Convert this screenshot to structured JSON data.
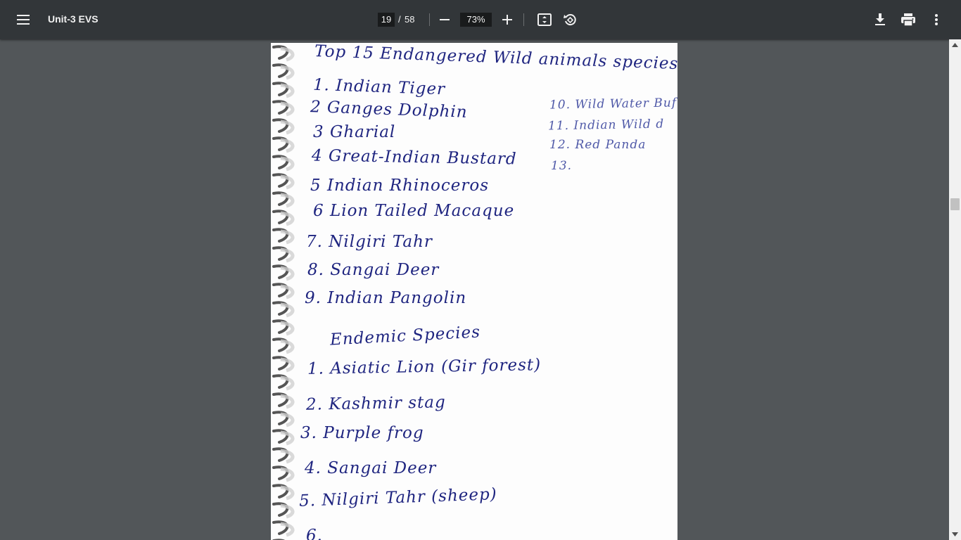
{
  "toolbar": {
    "title": "Unit-3 EVS",
    "page_current": "19",
    "page_separator": "/",
    "page_total": "58",
    "zoom": "73%",
    "icons": {
      "menu": "menu-icon",
      "zoom_out": "minus-icon",
      "zoom_in": "plus-icon",
      "fit": "fit-to-page-icon",
      "rotate": "rotate-icon",
      "download": "download-icon",
      "print": "print-icon",
      "more": "more-vert-icon"
    }
  },
  "page": {
    "heading": "Top 15   Endangered Wild animals species",
    "endangered_list": [
      "1. Indian Tiger",
      "2  Ganges Dolphin",
      "3  Gharial",
      "4  Great-Indian Bustard",
      "5  Indian Rhinoceros",
      "6  Lion Tailed Macaque",
      "7.  Nilgiri Tahr",
      "8.   Sangai Deer",
      "9.  Indian Pangolin"
    ],
    "side_list": [
      "10. Wild Water Buf",
      "11. Indian Wild d",
      "12. Red Panda",
      "13."
    ],
    "endemic_heading": "Endemic Species",
    "endemic_list": [
      "1. Asiatic Lion (Gir forest)",
      "2. Kashmir stag",
      "3. Purple frog",
      "4. Sangai Deer",
      "5. Nilgiri Tahr (sheep)",
      "6."
    ]
  },
  "colors": {
    "toolbar_bg": "#323639",
    "viewer_bg": "#525659",
    "ink": "#1f2580"
  }
}
